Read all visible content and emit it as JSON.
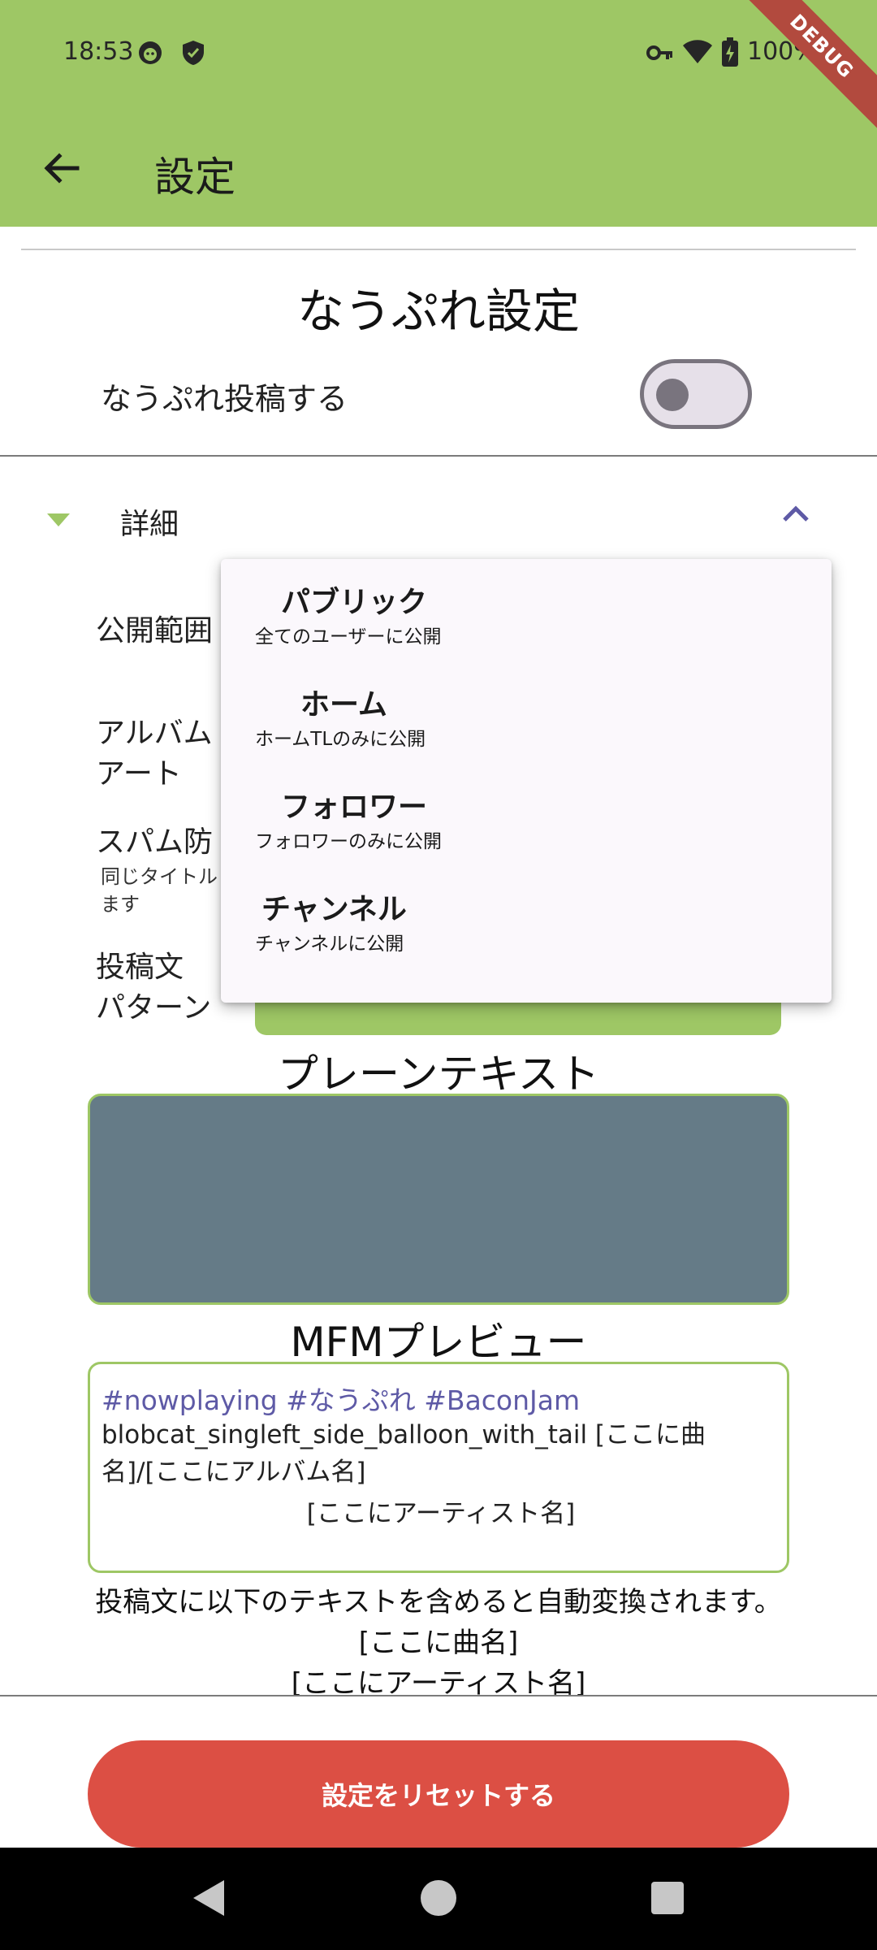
{
  "status_bar": {
    "time": "18:53",
    "battery": "100%",
    "icons": [
      "face-icon",
      "shield-icon",
      "vpn-key-icon",
      "wifi-icon",
      "battery-icon"
    ]
  },
  "debug_banner": "DEBUG",
  "app_bar": {
    "title": "設定",
    "back_icon": "arrow-back-icon"
  },
  "section": {
    "title": "なうぷれ設定",
    "toggle_label": "なうぷれ投稿する",
    "toggle_on": false
  },
  "details": {
    "label": "詳細",
    "expanded": true
  },
  "settings_rows": {
    "visibility_label": "公開範囲",
    "album_art_line1": "アルバム",
    "album_art_line2": "アート",
    "spam_label": "スパム防",
    "spam_sub_line1": "同じタイトル",
    "spam_sub_line2": "ます",
    "pattern_line1": "投稿文",
    "pattern_line2": "パターン"
  },
  "visibility_menu": {
    "items": [
      {
        "title": "パブリック",
        "subtitle": "全てのユーザーに公開"
      },
      {
        "title": "ホーム",
        "subtitle": "ホームTLのみに公開"
      },
      {
        "title": "フォロワー",
        "subtitle": "フォロワーのみに公開"
      },
      {
        "title": "チャンネル",
        "subtitle": "チャンネルに公開"
      }
    ]
  },
  "plain_text": {
    "heading": "プレーンテキスト",
    "value": ""
  },
  "mfm_preview": {
    "heading": "MFMプレビュー",
    "tags": "#nowplaying #なうぷれ #BaconJam",
    "body": "blobcat_singleft_side_balloon_with_tail [ここに曲名]/[ここにアルバム名]",
    "artist": "[ここにアーティスト名]"
  },
  "note": {
    "line1": "投稿文に以下のテキストを含めると自動変換されます。",
    "line2": "[ここに曲名]",
    "line3": "[ここにアーティスト名]"
  },
  "reset_button": "設定をリセットする",
  "colors": {
    "app_bar": "#9ec765",
    "accent_purple": "#5e5aa6",
    "reset_red": "#dc4f44",
    "plain_text_bg": "#657b87"
  },
  "nav_bar": [
    "back-triangle-icon",
    "home-circle-icon",
    "recents-square-icon"
  ]
}
